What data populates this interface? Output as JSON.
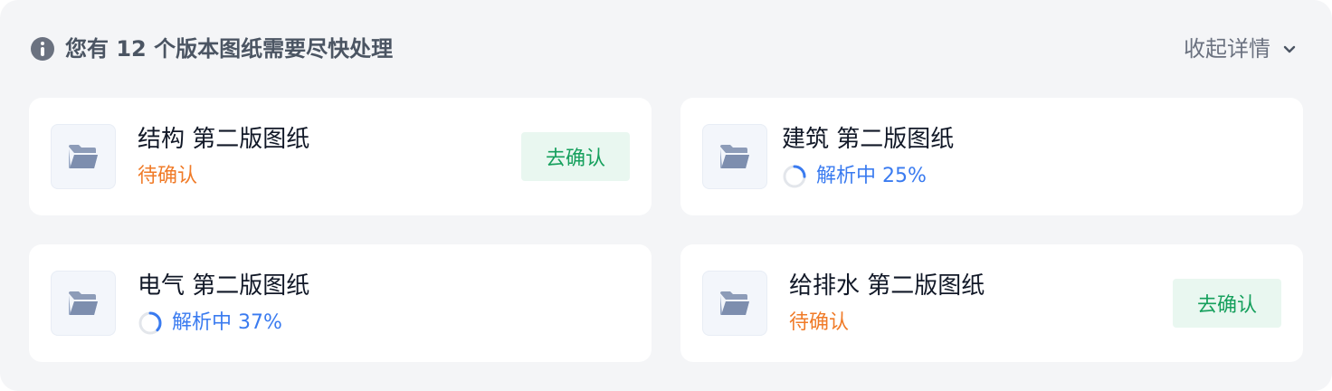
{
  "header": {
    "title": "您有 12 个版本图纸需要尽快处理",
    "collapse_label": "收起详情",
    "icon": "info-icon",
    "collapse_icon": "chevron-down-icon"
  },
  "colors": {
    "panel_bg": "#f4f5f7",
    "pending": "#f07b28",
    "parsing": "#3a7bf0",
    "confirm_text": "#16a05d",
    "confirm_bg": "#e9f7f0"
  },
  "cards": [
    {
      "title": "结构 第二版图纸",
      "status": "pending",
      "status_text": "待确认",
      "action_label": "去确认",
      "icon": "folder-icon"
    },
    {
      "title": "建筑 第二版图纸",
      "status": "parsing",
      "status_text": "解析中 25%",
      "progress": 0.25,
      "icon": "folder-icon"
    },
    {
      "title": "电气 第二版图纸",
      "status": "parsing",
      "status_text": "解析中 37%",
      "progress": 0.37,
      "icon": "folder-icon"
    },
    {
      "title": "给排水 第二版图纸",
      "status": "pending",
      "status_text": "待确认",
      "action_label": "去确认",
      "icon": "folder-icon"
    }
  ]
}
